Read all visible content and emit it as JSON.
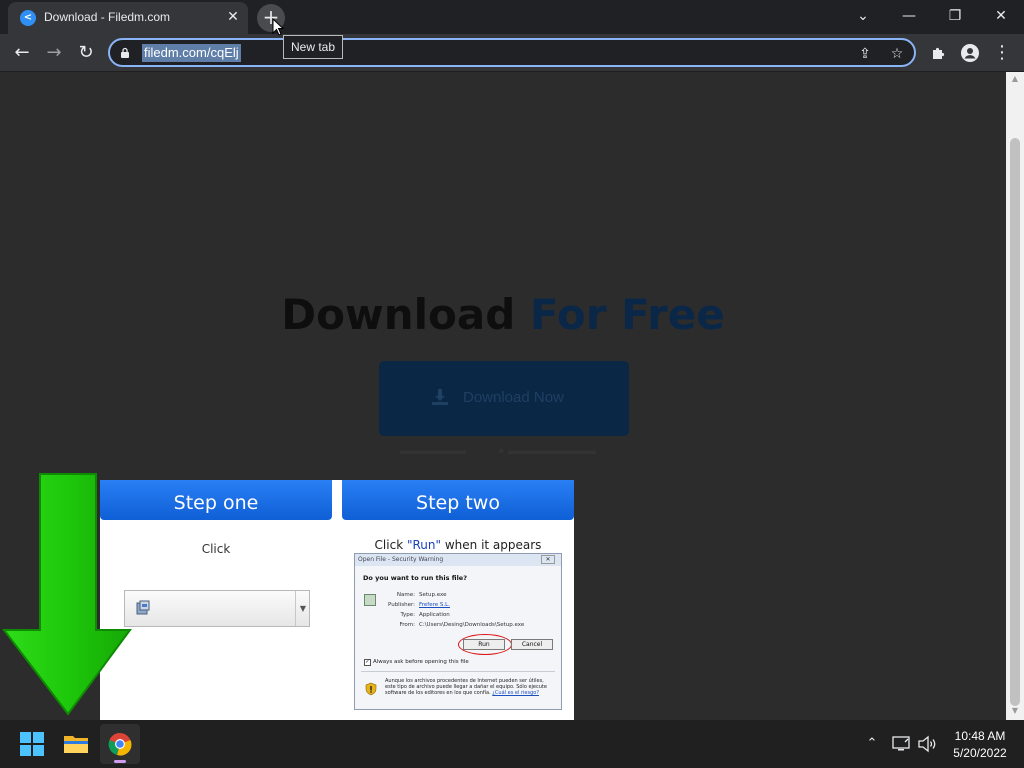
{
  "browser": {
    "tab": {
      "title": "Download - Filedm.com",
      "favicon": "share-icon",
      "close_glyph": "✕"
    },
    "new_tab_glyph": "+",
    "tooltip": "New tab",
    "window_controls": {
      "tab_search": "⌄",
      "minimize": "—",
      "restore": "❐",
      "close": "✕"
    },
    "nav": {
      "back": "←",
      "forward": "→",
      "reload": "↻"
    },
    "address": {
      "url": "filedm.com/cqElj",
      "lock_icon": "lock-icon"
    },
    "omnibox_icons": {
      "share": "⇪",
      "bookmark": "☆"
    },
    "toolbar_icons": {
      "extensions": "puzzle-icon",
      "profile": "profile-icon",
      "menu": "⋮"
    }
  },
  "page": {
    "headline_part1": "Download",
    "headline_part2": "For Free",
    "download_button": "Download Now",
    "ad": {
      "step_one": "Step one",
      "step_two": "Step two",
      "step_one_caption": "Click",
      "step_two_caption_pre": "Click ",
      "step_two_caption_run": "\"Run\"",
      "step_two_caption_post": " when it appears",
      "dialog": {
        "title": "Open File - Security Warning",
        "close": "✕",
        "question": "Do you want to run this file?",
        "name_label": "Name:",
        "name_value": "Setup.exe",
        "publisher_label": "Publisher:",
        "publisher_value": "Frefere S.L.",
        "type_label": "Type:",
        "type_value": "Application",
        "from_label": "From:",
        "from_value": "C:\\Users\\Desing\\Downloads\\Setup.exe",
        "run": "Run",
        "cancel": "Cancel",
        "checkbox_label": "Always ask before opening this file",
        "warning_text": "Aunque los archivos procedentes de Internet pueden ser útiles, este tipo de archivo puede llegar a dañar el equipo. Sólo ejecute software de los editores en los que confía.",
        "warning_link": "¿Cuál es el riesgo?"
      }
    }
  },
  "taskbar": {
    "apps": [
      "windows-start-icon",
      "file-explorer-icon",
      "chrome-icon"
    ],
    "tray_chevron": "⌃",
    "time": "10:48 AM",
    "date": "5/20/2022"
  },
  "colors": {
    "accent_blue": "#8ab4f8",
    "step_button_blue": "#1a6ee8",
    "arrow_green": "#22c80f"
  }
}
